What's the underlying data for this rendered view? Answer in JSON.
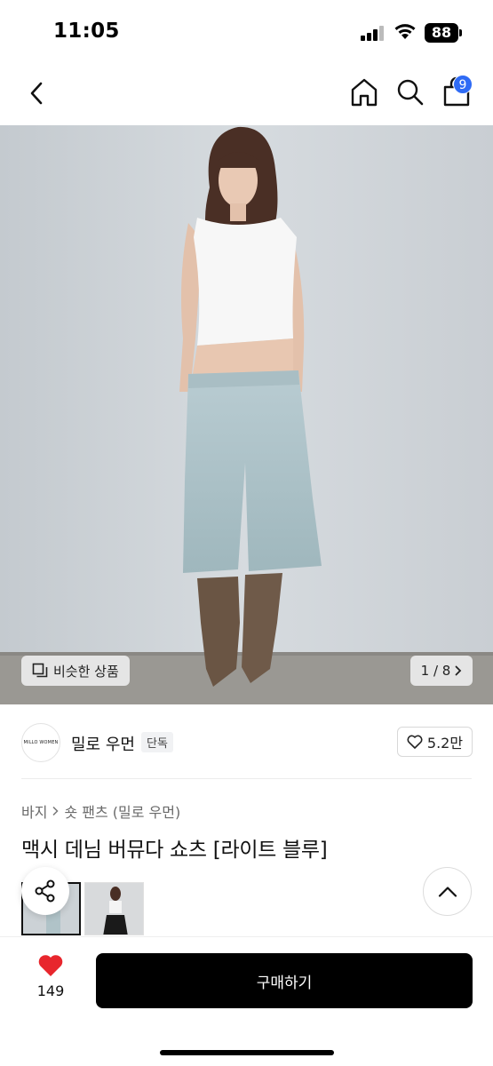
{
  "status_bar": {
    "time": "11:05",
    "battery": "88"
  },
  "nav": {
    "cart_badge": "9",
    "icons": [
      "back-icon",
      "home-icon",
      "search-icon",
      "shopping-bag-icon"
    ]
  },
  "hero": {
    "similar_label": "비슷한 상품",
    "counter": "1 / 8"
  },
  "brand": {
    "logo_text": "MILLO WOMEN",
    "name": "밀로 우먼",
    "badge": "단독",
    "likes": "5.2만"
  },
  "breadcrumb": {
    "category": "바지",
    "subcategory": "숏 팬츠 (밀로 우먼)"
  },
  "product": {
    "title": "맥시 데님 버뮤다 쇼츠 [라이트 블루]"
  },
  "bottom": {
    "wish_count": "149",
    "buy_label": "구매하기"
  },
  "colors": {
    "accent": "#2f6bf5",
    "wish": "#e8262d",
    "buy": "#000000"
  }
}
